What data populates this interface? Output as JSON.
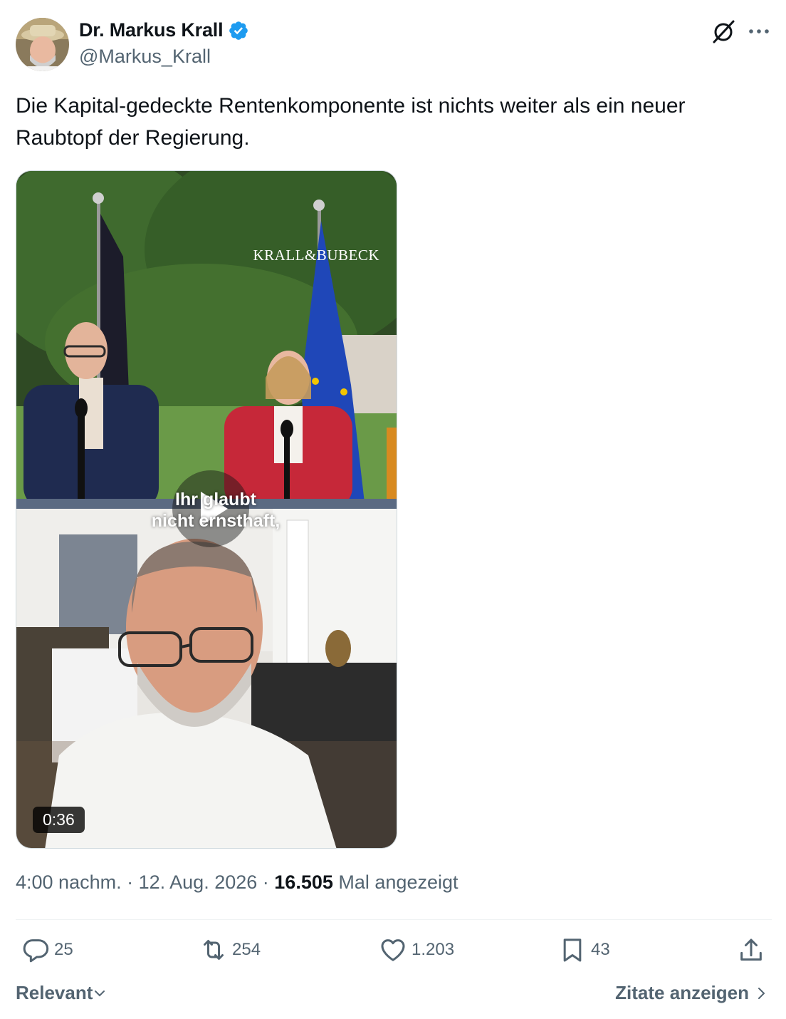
{
  "author": {
    "name": "Dr. Markus Krall",
    "handle": "@Markus_Krall",
    "verified": true
  },
  "post": {
    "text": "Die Kapital-gedeckte Rentenkomponente ist nichts weiter als ein neuer Raubtopf der Regierung."
  },
  "media": {
    "watermark": "KRALL&BUBECK",
    "subtitle_line1": "Ihr glaubt",
    "subtitle_line2": "nicht ernsthaft,",
    "duration": "0:36"
  },
  "meta": {
    "time": "4:00 nachm.",
    "date": "12. Aug. 2026",
    "views_count": "16.505",
    "views_label": "Mal angezeigt"
  },
  "actions": {
    "replies": "25",
    "reposts": "254",
    "likes": "1.203",
    "bookmarks": "43"
  },
  "footer": {
    "sort_label": "Relevant",
    "quotes_label": "Zitate anzeigen"
  },
  "colors": {
    "verified_blue": "#1d9bf0",
    "secondary_text": "#536471",
    "primary_text": "#0f1419"
  },
  "icons": [
    "verified-badge-icon",
    "grok-icon",
    "more-icon",
    "play-icon",
    "reply-icon",
    "repost-icon",
    "like-icon",
    "bookmark-icon",
    "share-icon",
    "chevron-down-icon",
    "chevron-right-icon"
  ]
}
